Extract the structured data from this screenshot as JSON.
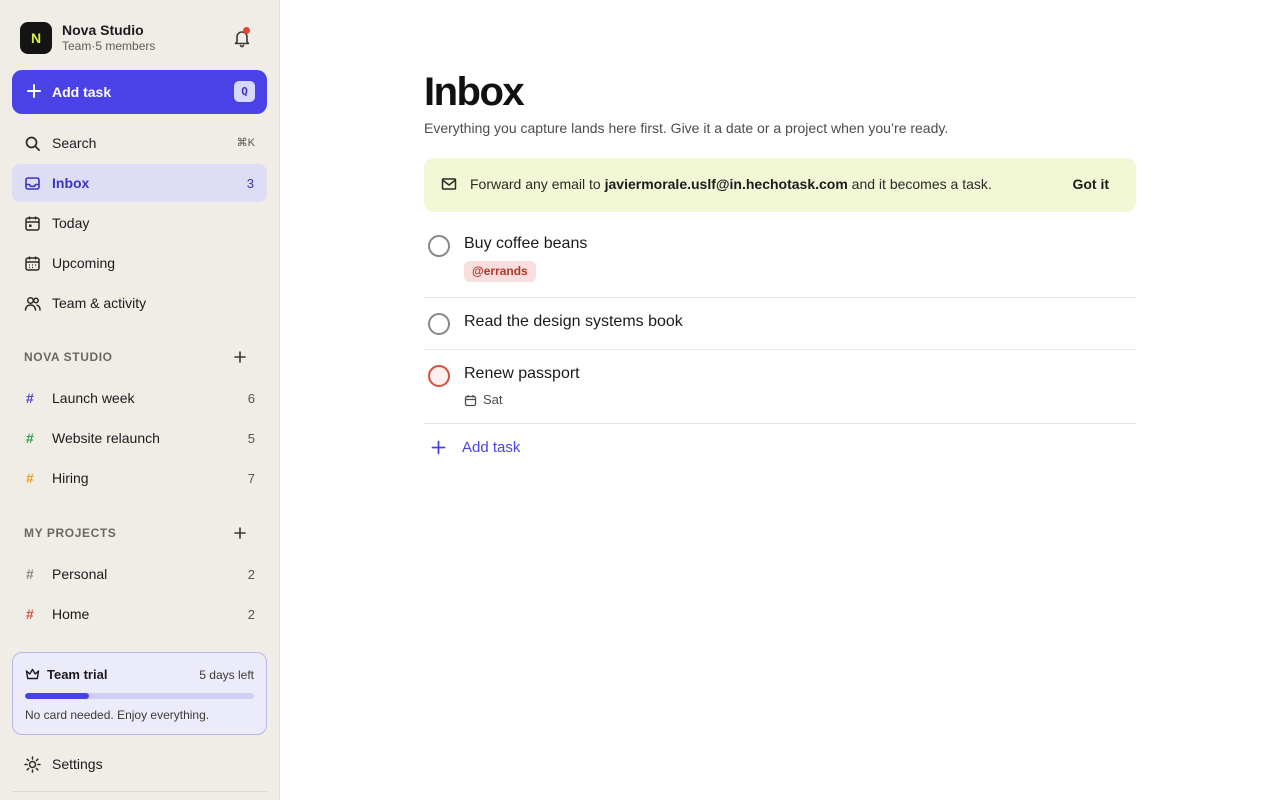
{
  "workspace": {
    "logo_letter": "N",
    "name": "Nova Studio",
    "subtitle": "Team·5 members"
  },
  "sidebar": {
    "add_task": {
      "label": "Add task",
      "shortcut": "Q"
    },
    "nav": [
      {
        "label": "Search",
        "icon": "search-icon",
        "shortcut": "⌘K"
      },
      {
        "label": "Inbox",
        "icon": "inbox-icon",
        "count": "3",
        "active": true
      },
      {
        "label": "Today",
        "icon": "calendar-today-icon"
      },
      {
        "label": "Upcoming",
        "icon": "calendar-upcoming-icon"
      },
      {
        "label": "Team & activity",
        "icon": "users-icon"
      }
    ],
    "team_section": {
      "title": "NOVA STUDIO",
      "projects": [
        {
          "name": "Launch week",
          "count": "6",
          "color": "#4a42e6"
        },
        {
          "name": "Website relaunch",
          "count": "5",
          "color": "#2f9a4d"
        },
        {
          "name": "Hiring",
          "count": "7",
          "color": "#e8a21e"
        }
      ]
    },
    "my_section": {
      "title": "MY PROJECTS",
      "projects": [
        {
          "name": "Personal",
          "count": "2",
          "color": "#8a8883"
        },
        {
          "name": "Home",
          "count": "2",
          "color": "#d6503f"
        }
      ]
    },
    "trial": {
      "title": "Team trial",
      "remaining": "5 days left",
      "progress_fraction": 0.28,
      "note": "No card needed. Enjoy everything."
    },
    "settings_label": "Settings"
  },
  "main": {
    "title": "Inbox",
    "subtitle": "Everything you capture lands here first. Give it a date or a project when you’re ready.",
    "banner": {
      "prefix": "Forward any email to ",
      "email": "javiermorale.uslf@in.hechotask.com",
      "suffix": " and it becomes a task.",
      "dismiss": "Got it"
    },
    "tasks": [
      {
        "title": "Buy coffee beans",
        "label": "@errands"
      },
      {
        "title": "Read the design systems book"
      },
      {
        "title": "Renew passport",
        "due": "Sat",
        "priority": "high"
      }
    ],
    "add_task_label": "Add task"
  },
  "colors": {
    "accent": "#4a42e6",
    "sidebar_bg": "#f0ede6",
    "banner_bg": "#f2f8d6",
    "priority": "#d6503f"
  }
}
